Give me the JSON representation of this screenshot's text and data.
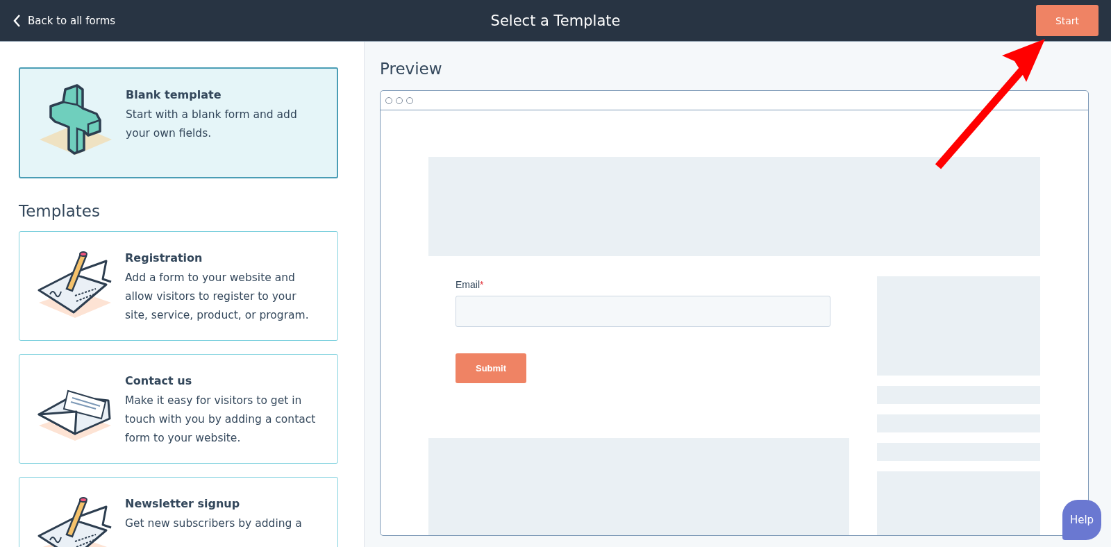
{
  "header": {
    "back_link": "Back to all forms",
    "title": "Select a Template",
    "start_button": "Start"
  },
  "blank_template": {
    "title": "Blank template",
    "description": "Start with a blank form and add your own fields.",
    "selected": true,
    "kind": "cross"
  },
  "templates_heading": "Templates",
  "templates": [
    {
      "title": "Registration",
      "description": "Add a form to your website and allow visitors to register to your site, service, product, or program.",
      "selected": false,
      "kind": "pencil"
    },
    {
      "title": "Contact us",
      "description": "Make it easy for visitors to get in touch with you by adding a contact form to your website.",
      "selected": false,
      "kind": "envelope"
    },
    {
      "title": "Newsletter signup",
      "description": "Get new subscribers by adding a",
      "selected": false,
      "kind": "pencil"
    }
  ],
  "preview": {
    "heading": "Preview",
    "form": {
      "field_label": "Email",
      "required_mark": "*",
      "submit_button": "Submit"
    }
  },
  "help_button": "Help"
}
